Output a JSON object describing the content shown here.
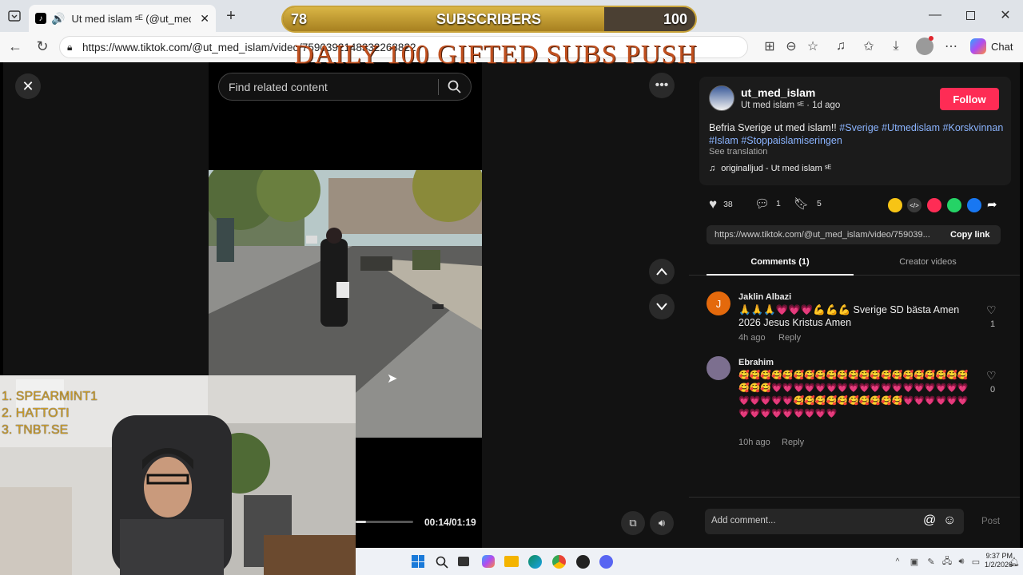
{
  "browser": {
    "tab_title": "Ut med islam ˢᴱ (@ut_med_isl",
    "url": "https://www.tiktok.com/@ut_med_islam/video/7590392148332268822",
    "chat_label": "Chat"
  },
  "overlay": {
    "sub_current": "78",
    "sub_label": "SUBSCRIBERS",
    "sub_goal": "100",
    "progress": 0.78,
    "title": "DAILY 100 GIFTED SUBS PUSH"
  },
  "player": {
    "search_placeholder": "Find related content",
    "time": "00:14/01:19",
    "progress": 0.18
  },
  "post": {
    "username": "ut_med_islam",
    "display": "Ut med islam ˢᴱ",
    "age": "1d ago",
    "follow_label": "Follow",
    "caption_plain": "Befria Sverige ut med islam!!",
    "tag1": "#Sverige",
    "tag2": "#Utmedislam",
    "tag3": "#Korskvinnan",
    "tag4": "#Islam",
    "tag5": "#Stoppaislamiseringen",
    "see_translation": "See translation",
    "sound": "originalljud - Ut med islam ˢᴱ",
    "likes": "38",
    "comments": "1",
    "saves": "5",
    "link_url": "https://www.tiktok.com/@ut_med_islam/video/759039...",
    "copy_link": "Copy link",
    "tab_comments": "Comments (1)",
    "tab_creator": "Creator videos"
  },
  "comments": [
    {
      "avatar": "J",
      "name": "Jaklin Albazi",
      "text": "🙏🙏🙏💗💗💗💪💪💪 Sverige SD bästa Amen 2026 Jesus Kristus Amen",
      "age": "4h ago",
      "reply": "Reply",
      "likes": "1"
    },
    {
      "avatar": "",
      "name": "Ebrahim",
      "text": "🥰🥰🥰🥰🥰🥰🥰🥰🥰🥰🥰🥰🥰🥰🥰🥰🥰🥰🥰🥰🥰🥰🥰🥰💗💗💗💗💗💗💗💗💗💗💗💗💗💗💗💗💗💗💗💗💗💗💗🥰🥰🥰🥰🥰🥰🥰🥰🥰🥰💗💗💗💗💗💗💗💗💗💗💗💗💗💗💗",
      "age": "10h ago",
      "reply": "Reply",
      "likes": "0"
    }
  ],
  "composer": {
    "placeholder": "Add comment...",
    "post_label": "Post"
  },
  "stream_list": [
    "1.  SPEARMINT1",
    "2.    HATTOTI",
    "3.  TNBT.SE"
  ],
  "clock": {
    "time": "9:37 PM",
    "date": "1/2/2026"
  },
  "colors": {
    "follow": "#fe2c55",
    "tag": "#8bb4ff",
    "overlay_gold": "#c9a43a",
    "overlay_title": "#c0501f"
  }
}
